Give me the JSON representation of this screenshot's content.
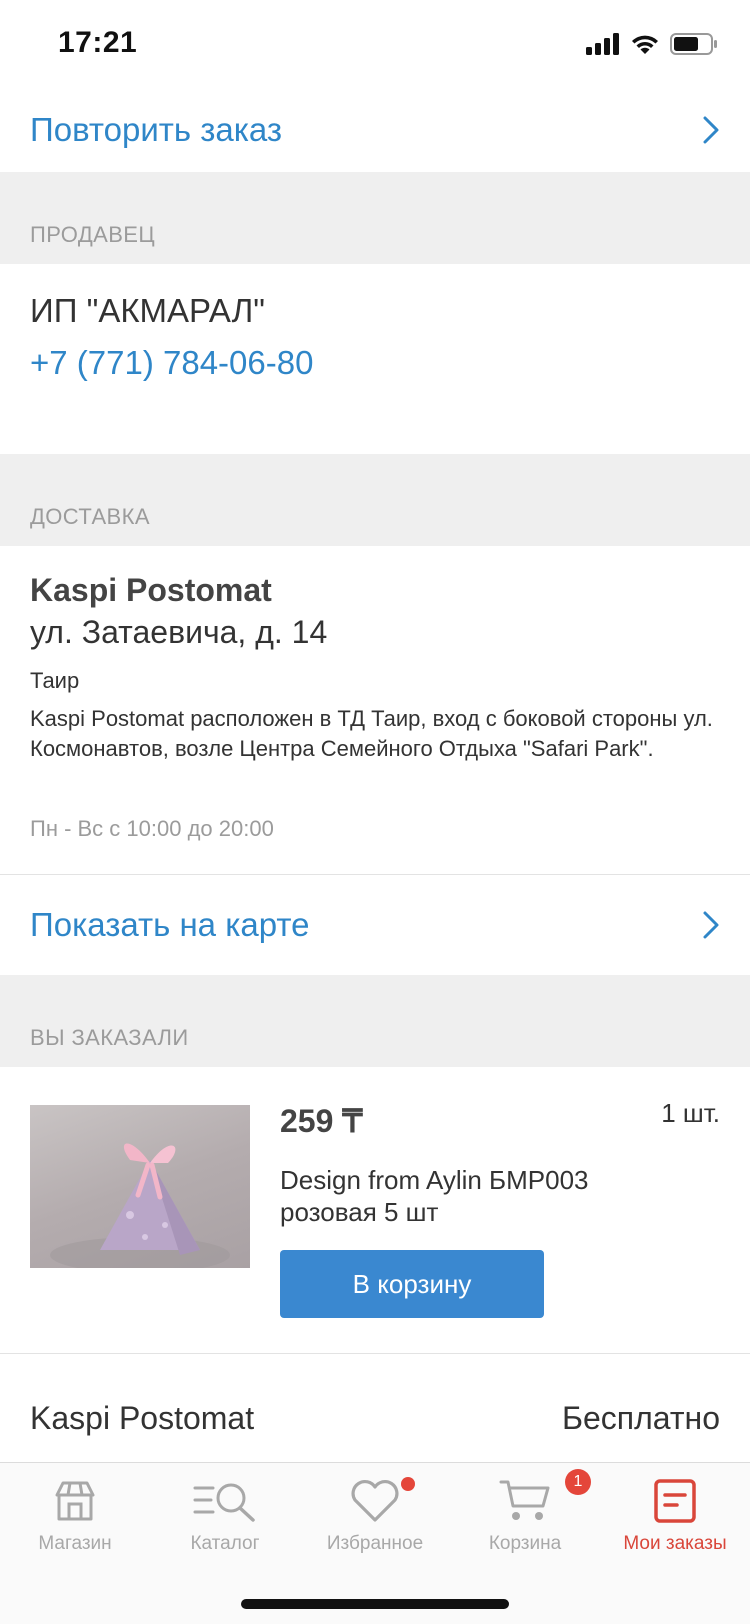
{
  "status": {
    "time": "17:21"
  },
  "repeat_order": {
    "label": "Повторить заказ"
  },
  "seller": {
    "header": "ПРОДАВЕЦ",
    "name": "ИП \"АКМАРАЛ\"",
    "phone": "+7 (771) 784-06-80"
  },
  "delivery": {
    "header": "ДОСТАВКА",
    "title": "Kaspi Postomat",
    "address": "ул. Затаевича, д. 14",
    "place": "Таир",
    "description": "Kaspi Postomat расположен в ТД Таир, вход с боковой стороны ул. Космонавтов, возле Центра Семейного Отдыха \"Safari Park\".",
    "hours": "Пн - Вс с 10:00 до 20:00",
    "map_link": "Показать на карте"
  },
  "ordered": {
    "header": "ВЫ ЗАКАЗАЛИ",
    "item": {
      "price": "259 ₸",
      "quantity": "1 шт.",
      "name": "Design from Aylin БМР003 розовая 5 шт",
      "cart_button": "В корзину"
    },
    "shipping_label": "Kaspi Postomat",
    "shipping_value": "Бесплатно"
  },
  "tabs": [
    {
      "label": "Магазин",
      "icon": "store-icon"
    },
    {
      "label": "Каталог",
      "icon": "catalog-search-icon"
    },
    {
      "label": "Избранное",
      "icon": "heart-icon"
    },
    {
      "label": "Корзина",
      "icon": "cart-icon",
      "badge": "1"
    },
    {
      "label": "Мои заказы",
      "icon": "orders-icon",
      "active": true
    }
  ],
  "colors": {
    "link": "#2f86c8",
    "accent": "#d9463a",
    "button": "#3a88d0",
    "badge": "#e4463a"
  }
}
